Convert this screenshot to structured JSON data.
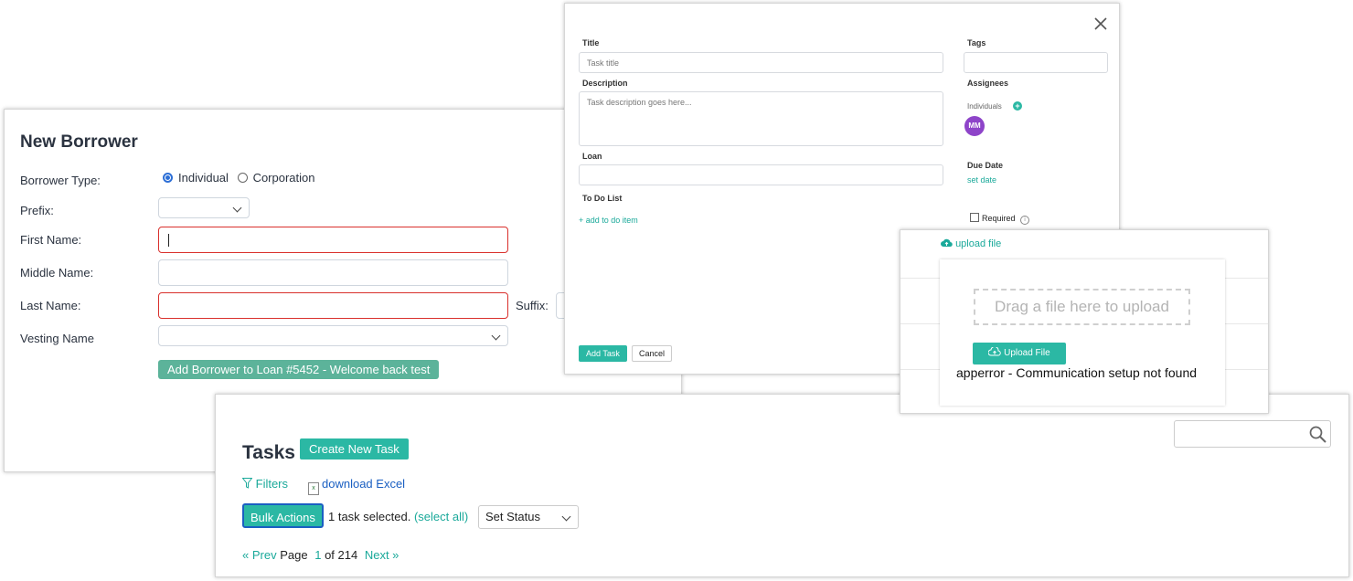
{
  "borrower": {
    "title": "New Borrower",
    "borrower_type_label": "Borrower Type:",
    "type_options": [
      "Individual",
      "Corporation"
    ],
    "selected_type": "Individual",
    "prefix_label": "Prefix:",
    "first_name_label": "First Name:",
    "middle_name_label": "Middle Name:",
    "last_name_label": "Last Name:",
    "suffix_label": "Suffix:",
    "vesting_label": "Vesting Name",
    "add_button": "Add Borrower to Loan #5452 - Welcome back test"
  },
  "task_dialog": {
    "title_label": "Title",
    "title_placeholder": "Task title",
    "description_label": "Description",
    "description_placeholder": "Task description goes here...",
    "loan_label": "Loan",
    "todo_label": "To Do List",
    "add_todo": "+ add to do item",
    "tags_label": "Tags",
    "assignees_label": "Assignees",
    "individuals_label": "Individuals",
    "avatar_initials": "MM",
    "due_date_label": "Due Date",
    "set_date": "set date",
    "required_label": "Required",
    "add_task_button": "Add Task",
    "cancel_button": "Cancel"
  },
  "upload": {
    "link": "upload file",
    "drop_text": "Drag a file here to upload",
    "button": "Upload File",
    "error": "apperror - Communication setup not found"
  },
  "tasks": {
    "title": "Tasks",
    "create_button": "Create New Task",
    "filters": "Filters",
    "download": "download Excel",
    "bulk_actions": "Bulk Actions",
    "selected_text": "1 task selected.",
    "select_all": "(select all)",
    "set_status": "Set Status",
    "prev": "« Prev",
    "page_word": "Page",
    "page_current": "1",
    "page_total": "of 214",
    "next": "Next »"
  },
  "colors": {
    "teal": "#2bb8a4",
    "green_button": "#5cb39a",
    "error_border": "#d9302c",
    "radio_blue": "#2d6fd6",
    "avatar_purple": "#8e44c9",
    "link_blue": "#1a5fc2"
  }
}
